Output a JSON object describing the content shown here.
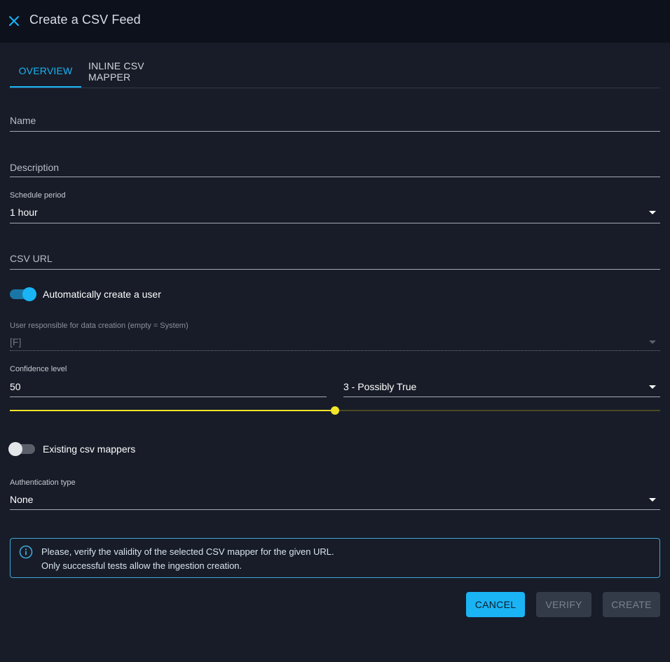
{
  "header": {
    "title": "Create a CSV Feed",
    "close_icon": "close-icon"
  },
  "tabs": [
    {
      "label": "OVERVIEW",
      "active": true
    },
    {
      "label": "INLINE CSV MAPPER",
      "active": false
    }
  ],
  "form": {
    "name": {
      "label": "Name",
      "value": ""
    },
    "description": {
      "label": "Description",
      "value": ""
    },
    "schedule_period": {
      "label": "Schedule period",
      "value": "1 hour"
    },
    "csv_url": {
      "label": "CSV URL",
      "value": ""
    },
    "auto_create_user": {
      "label": "Automatically create a user",
      "checked": true
    },
    "user_responsible": {
      "label": "User responsible for data creation (empty = System)",
      "value": "[F]",
      "disabled": true
    },
    "confidence": {
      "label": "Confidence level",
      "value": "50",
      "level_label": "3 - Possibly True",
      "slider_fraction": 0.5
    },
    "existing_csv_mappers": {
      "label": "Existing csv mappers",
      "checked": false
    },
    "authentication_type": {
      "label": "Authentication type",
      "value": "None"
    }
  },
  "alert": {
    "icon": "info-icon",
    "line1": "Please, verify the validity of the selected CSV mapper for the given URL.",
    "line2": "Only successful tests allow the ingestion creation."
  },
  "buttons": {
    "cancel": "CANCEL",
    "verify": "VERIFY",
    "create": "CREATE"
  },
  "colors": {
    "accent": "#1ab4f5",
    "background": "#171c28",
    "header_background": "#0c111c",
    "slider": "#f3e52a"
  }
}
